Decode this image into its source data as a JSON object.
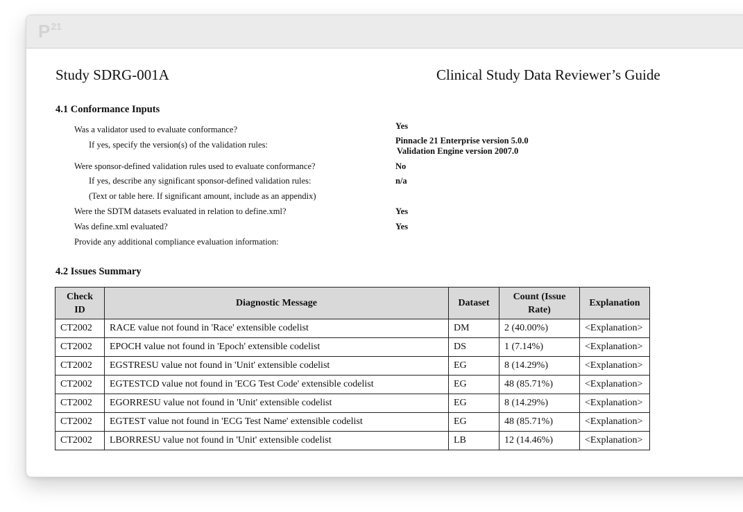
{
  "app": {
    "logo_main": "P",
    "logo_sup": "21"
  },
  "document": {
    "study_title": "Study SDRG-001A",
    "guide_title": "Clinical Study Data Reviewer’s Guide"
  },
  "section_41": {
    "title": "4.1  Conformance Inputs",
    "questions": [
      "Was a validator used to evaluate conformance?",
      "If yes, specify the version(s) of the validation rules:",
      "Were sponsor-defined validation rules used to evaluate conformance?",
      "If yes, describe any significant sponsor-defined validation rules:",
      "(Text or table here.  If significant amount, include as an appendix)",
      "Were the SDTM datasets evaluated in relation to define.xml?",
      "Was define.xml evaluated?",
      "Provide any additional compliance evaluation information:"
    ],
    "answers": {
      "validator_used": "Yes",
      "version_line1": "Pinnacle 21 Enterprise version 5.0.0",
      "version_line2": "Validation Engine version 2007.0",
      "sponsor_rules": "No",
      "sponsor_rules_desc": "n/a",
      "sdtm_vs_define": "Yes",
      "define_evaluated": "Yes"
    }
  },
  "section_42": {
    "title": "4.2  Issues Summary",
    "headers": {
      "check_id_1": "Check",
      "check_id_2": "ID",
      "diagnostic": "Diagnostic Message",
      "dataset": "Dataset",
      "count_1": "Count (Issue",
      "count_2": "Rate)",
      "explanation": "Explanation"
    },
    "rows": [
      {
        "check_id": "CT2002",
        "message": "RACE value not found in 'Race' extensible codelist",
        "dataset": "DM",
        "count": "2 (40.00%)",
        "explanation": "<Explanation>"
      },
      {
        "check_id": "CT2002",
        "message": "EPOCH value not found in 'Epoch' extensible codelist",
        "dataset": "DS",
        "count": "1 (7.14%)",
        "explanation": "<Explanation>"
      },
      {
        "check_id": "CT2002",
        "message": "EGSTRESU value not found in 'Unit' extensible codelist",
        "dataset": "EG",
        "count": "8 (14.29%)",
        "explanation": "<Explanation>"
      },
      {
        "check_id": "CT2002",
        "message": "EGTESTCD value not found in 'ECG Test Code' extensible codelist",
        "dataset": "EG",
        "count": "48 (85.71%)",
        "explanation": "<Explanation>"
      },
      {
        "check_id": "CT2002",
        "message": "EGORRESU value not found in 'Unit' extensible codelist",
        "dataset": "EG",
        "count": "8 (14.29%)",
        "explanation": "<Explanation>"
      },
      {
        "check_id": "CT2002",
        "message": "EGTEST value not found in 'ECG Test Name' extensible codelist",
        "dataset": "EG",
        "count": "48 (85.71%)",
        "explanation": "<Explanation>"
      },
      {
        "check_id": "CT2002",
        "message": "LBORRESU value not found in 'Unit' extensible codelist",
        "dataset": "LB",
        "count": "12 (14.46%)",
        "explanation": "<Explanation>"
      }
    ]
  }
}
